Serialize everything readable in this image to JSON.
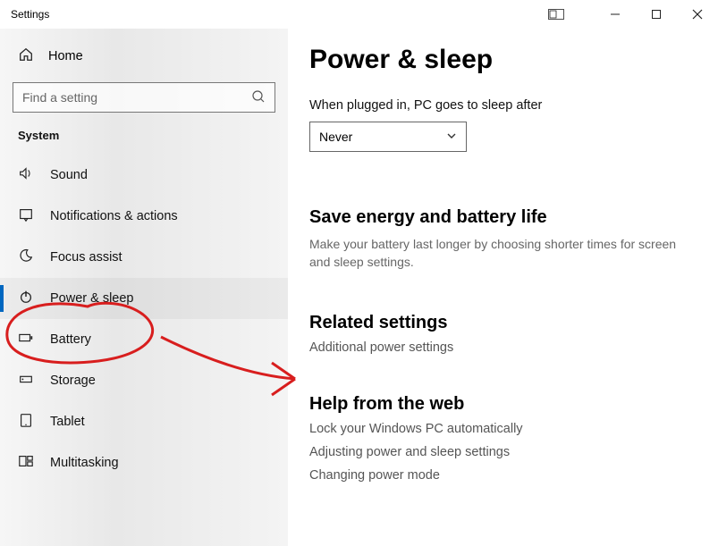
{
  "window": {
    "title": "Settings"
  },
  "sidebar": {
    "home_label": "Home",
    "search_placeholder": "Find a setting",
    "section": "System",
    "items": [
      {
        "label": "Sound",
        "icon": "volume-icon",
        "selected": false
      },
      {
        "label": "Notifications & actions",
        "icon": "notification-icon",
        "selected": false
      },
      {
        "label": "Focus assist",
        "icon": "moon-icon",
        "selected": false
      },
      {
        "label": "Power & sleep",
        "icon": "power-icon",
        "selected": true
      },
      {
        "label": "Battery",
        "icon": "battery-icon",
        "selected": false
      },
      {
        "label": "Storage",
        "icon": "storage-icon",
        "selected": false
      },
      {
        "label": "Tablet",
        "icon": "tablet-icon",
        "selected": false
      },
      {
        "label": "Multitasking",
        "icon": "multitask-icon",
        "selected": false
      }
    ]
  },
  "main": {
    "heading": "Power & sleep",
    "sleep_label": "When plugged in, PC goes to sleep after",
    "sleep_value": "Never",
    "energy_heading": "Save energy and battery life",
    "energy_text": "Make your battery last longer by choosing shorter times for screen and sleep settings.",
    "related_heading": "Related settings",
    "related_link": "Additional power settings",
    "help_heading": "Help from the web",
    "help_links": [
      "Lock your Windows PC automatically",
      "Adjusting power and sleep settings",
      "Changing power mode"
    ]
  }
}
